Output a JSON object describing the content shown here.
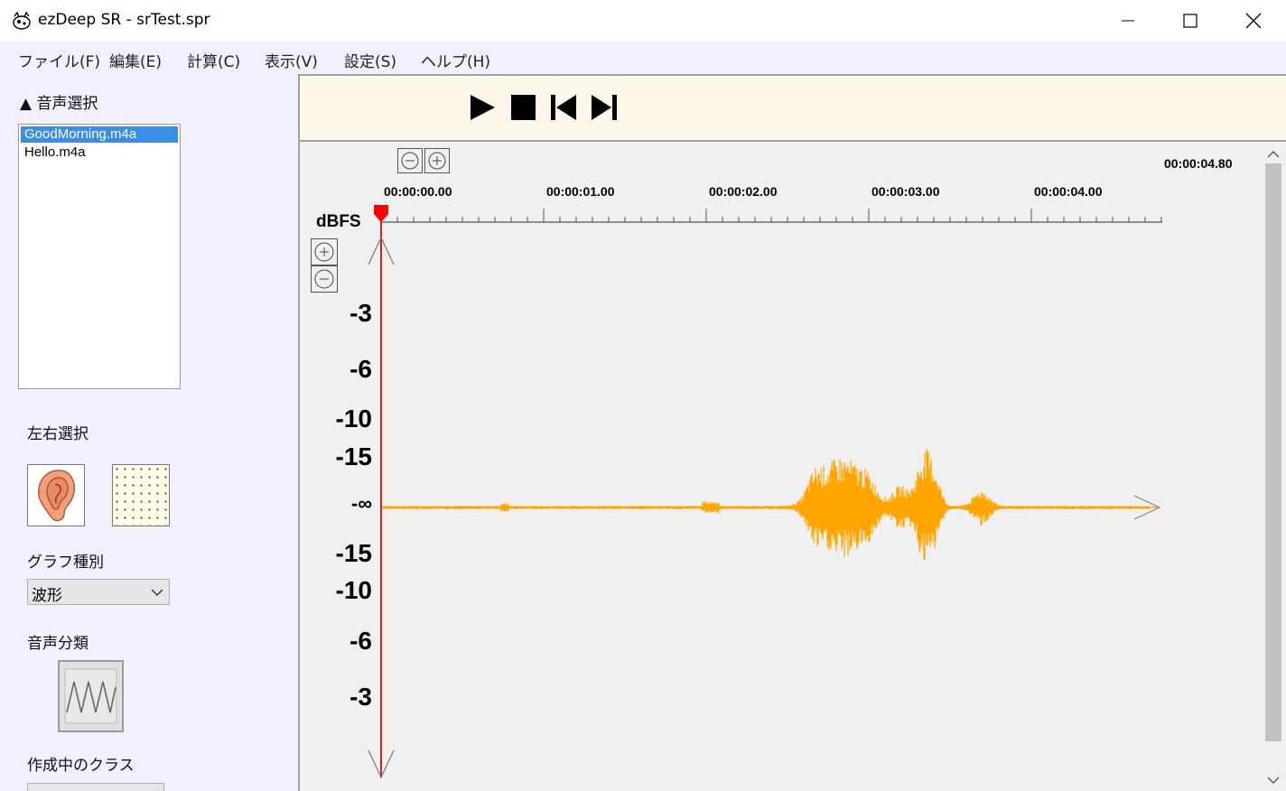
{
  "window": {
    "title": "ezDeep SR - srTest.spr",
    "app_icon": "app-logo-icon",
    "controls": [
      "minimize-icon",
      "maximize-icon",
      "close-icon"
    ]
  },
  "menu": [
    {
      "label": "ファイル(F)"
    },
    {
      "label": "編集(E)"
    },
    {
      "label": "計算(C)"
    },
    {
      "label": "表示(V)"
    },
    {
      "label": "設定(S)"
    },
    {
      "label": "ヘルプ(H)"
    }
  ],
  "sidebar": {
    "audio_select": {
      "label": "▲ 音声選択",
      "files": [
        {
          "name": "GoodMorning.m4a",
          "selected": true
        },
        {
          "name": "Hello.m4a",
          "selected": false
        }
      ]
    },
    "lr_select": {
      "label": "左右選択",
      "options": [
        "ear-icon",
        "dotted-pattern"
      ]
    },
    "graph_type": {
      "label": "グラフ種別",
      "value": "波形"
    },
    "audio_class": {
      "label": "音声分類",
      "icon": "waveform-icon"
    },
    "current_class": {
      "label": "作成中のクラス"
    }
  },
  "toolbar": {
    "buttons": [
      "play-icon",
      "stop-icon",
      "skip-to-start-icon",
      "skip-to-end-icon"
    ]
  },
  "waveform": {
    "total_time": "00:00:04.80",
    "time_ticks": [
      "00:00:00.00",
      "00:00:01.00",
      "00:00:02.00",
      "00:00:03.00",
      "00:00:04.00"
    ],
    "unit_label": "dBFS",
    "db_labels": [
      "-3",
      "-6",
      "-10",
      "-15",
      "-∞",
      "-15",
      "-10",
      "-6",
      "-3"
    ],
    "cursor_time": "00:00:00.00",
    "wave_color": "#ffa500",
    "cursor_color": "#e02020"
  }
}
